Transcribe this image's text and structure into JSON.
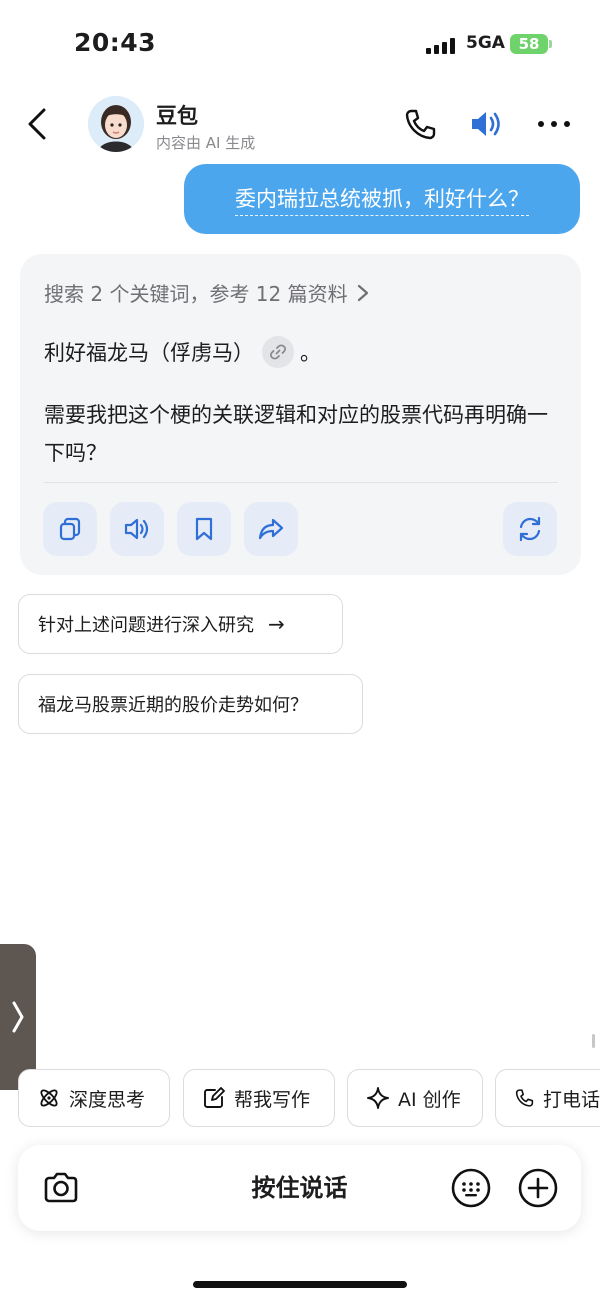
{
  "status_bar": {
    "time": "20:43",
    "network": "5GA",
    "battery": "58"
  },
  "header": {
    "bot_name": "豆包",
    "subtitle": "内容由 AI 生成"
  },
  "chat": {
    "user_message": "委内瑞拉总统被抓，利好什么？",
    "search_summary": "搜索 2 个关键词，参考 12 篇资料",
    "answer_line1": "利好福龙马（俘虏马）",
    "answer_line1_end": "。",
    "answer_line2": "需要我把这个梗的关联逻辑和对应的股票代码再明确一下吗？"
  },
  "suggestions": [
    {
      "label": "针对上述问题进行深入研究",
      "arrow": "→"
    },
    {
      "label": "福龙马股票近期的股价走势如何？"
    }
  ],
  "quick_actions": [
    {
      "label": "深度思考",
      "icon": "atom-icon"
    },
    {
      "label": "帮我写作",
      "icon": "edit-icon"
    },
    {
      "label": "AI 创作",
      "icon": "sparkle-icon"
    },
    {
      "label": "打电话",
      "icon": "phone-icon"
    }
  ],
  "input": {
    "hold_to_talk": "按住说话"
  },
  "colors": {
    "accent": "#4ba6ee",
    "icon_blue": "#2f6fd6",
    "card_bg": "#f4f5f7"
  }
}
